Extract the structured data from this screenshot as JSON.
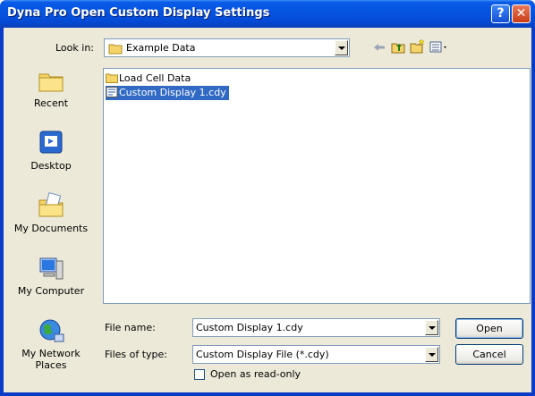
{
  "window": {
    "title": "Dyna Pro Open Custom Display Settings",
    "help_glyph": "?",
    "close_glyph": "✕"
  },
  "lookin": {
    "label": "Look in:",
    "value": "Example Data"
  },
  "places": [
    {
      "label": "Recent",
      "icon": "recent-folder-icon"
    },
    {
      "label": "Desktop",
      "icon": "desktop-icon"
    },
    {
      "label": "My Documents",
      "icon": "my-documents-icon"
    },
    {
      "label": "My Computer",
      "icon": "my-computer-icon"
    },
    {
      "label": "My Network Places",
      "icon": "my-network-places-icon"
    }
  ],
  "files": [
    {
      "name": "Load Cell Data",
      "type": "folder",
      "selected": false
    },
    {
      "name": "Custom Display 1.cdy",
      "type": "file",
      "selected": true
    }
  ],
  "filename": {
    "label": "File name:",
    "value": "Custom Display 1.cdy"
  },
  "filetype": {
    "label": "Files of type:",
    "value": "Custom Display File (*.cdy)"
  },
  "readonly": {
    "label": "Open as read-only",
    "checked": false
  },
  "buttons": {
    "open": "Open",
    "cancel": "Cancel"
  },
  "colors": {
    "titlebar": "#0553e0",
    "selection": "#316ac5",
    "dialog": "#ece9d8"
  }
}
